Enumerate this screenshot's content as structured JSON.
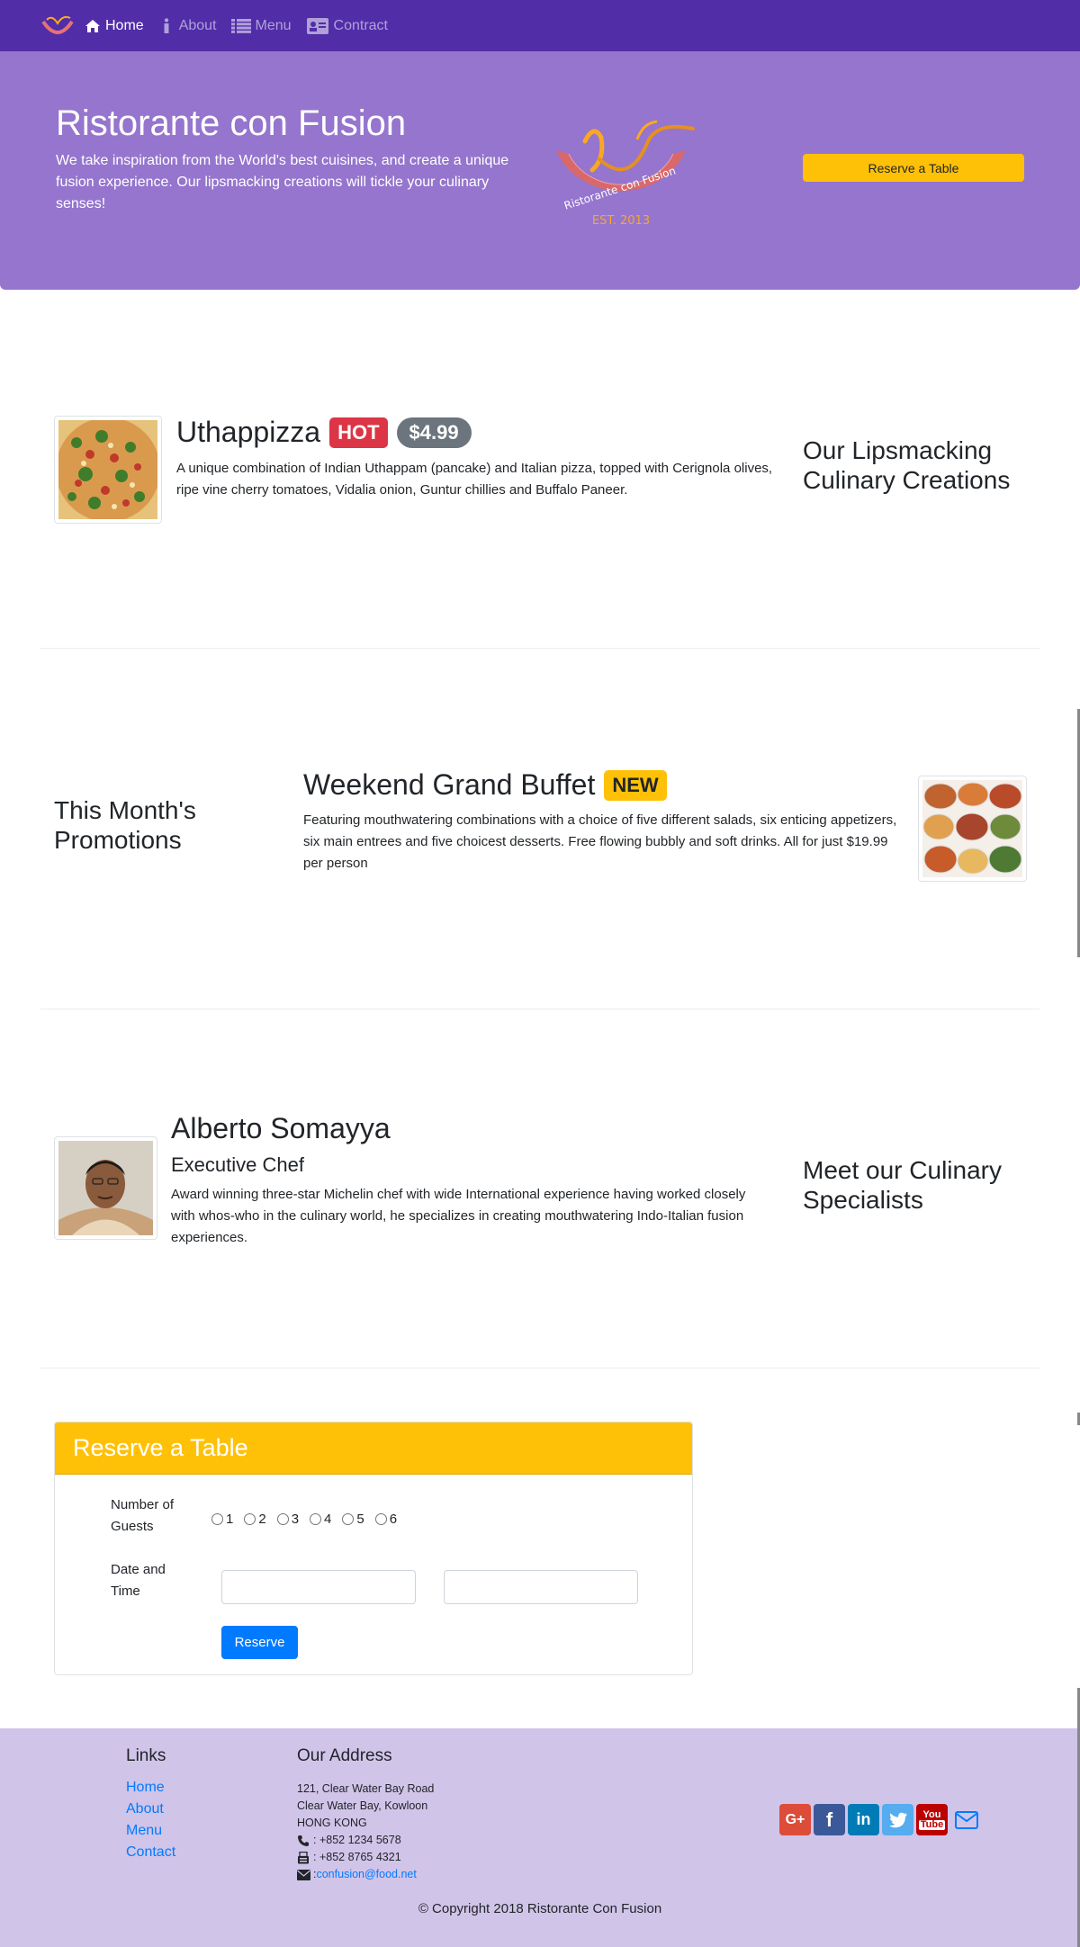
{
  "nav": {
    "items": [
      {
        "label": "Home",
        "icon": "home-icon"
      },
      {
        "label": "About",
        "icon": "info-icon"
      },
      {
        "label": "Menu",
        "icon": "list-icon"
      },
      {
        "label": "Contract",
        "icon": "address-card-icon"
      }
    ]
  },
  "jumbotron": {
    "title": "Ristorante con Fusion",
    "text": "We take inspiration from the World's best cuisines, and create a unique fusion experience. Our lipsmacking creations will tickle your culinary senses!",
    "reserve_label": "Reserve a Table"
  },
  "dish": {
    "name": "Uthappizza",
    "badge": "HOT",
    "price": "$4.99",
    "description": "A unique combination of Indian Uthappam (pancake) and Italian pizza, topped with Cerignola olives, ripe vine cherry tomatoes, Vidalia onion, Guntur chillies and Buffalo Paneer.",
    "side_heading": "Our Lipsmacking Culinary Creations"
  },
  "promotion": {
    "side_heading": "This Month's Promotions",
    "name": "Weekend Grand Buffet",
    "badge": "NEW",
    "description": "Featuring mouthwatering combinations with a choice of five different salads, six enticing appetizers, six main entrees and five choicest desserts. Free flowing bubbly and soft drinks. All for just $19.99 per person"
  },
  "leader": {
    "name": "Alberto Somayya",
    "designation": "Executive Chef",
    "description": "Award winning three-star Michelin chef with wide International experience having worked closely with whos-who in the culinary world, he specializes in creating mouthwatering Indo-Italian fusion experiences.",
    "side_heading": "Meet our Culinary Specialists"
  },
  "reservation": {
    "title": "Reserve a Table",
    "guests_label": "Number of Guests",
    "guest_options": [
      "1",
      "2",
      "3",
      "4",
      "5",
      "6"
    ],
    "datetime_label": "Date and Time",
    "date_value": "",
    "time_value": "",
    "submit_label": "Reserve"
  },
  "footer": {
    "links_heading": "Links",
    "links": [
      "Home",
      "About",
      "Menu",
      "Contact"
    ],
    "address_heading": "Our Address",
    "address_lines": [
      "121, Clear Water Bay Road",
      "Clear Water Bay, Kowloon",
      "HONG KONG"
    ],
    "phone": ": +852 1234 5678",
    "fax": ": +852 8765 4321",
    "email_prefix": ": ",
    "email": "confusion@food.net",
    "copyright": "© Copyright 2018 Ristorante Con Fusion",
    "colors": {
      "google": "#dd4b39",
      "facebook": "#3b5998",
      "linkedin": "#007bb6",
      "twitter": "#55acee",
      "youtube": "#bb0000",
      "mail": "#007bff"
    }
  },
  "colors": {
    "navbar": "#512da8",
    "jumbotron": "#9575cd",
    "footer": "#d1c4e9",
    "warning": "#ffc107",
    "primary": "#007bff"
  }
}
